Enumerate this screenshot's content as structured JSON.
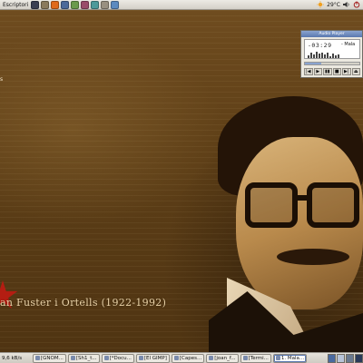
{
  "top_panel": {
    "menu_label": "Escriptori",
    "launchers": [
      {
        "icon": "terminal-icon",
        "color": "#3a3f52"
      },
      {
        "icon": "gimp-icon",
        "color": "#8a7a5c"
      },
      {
        "icon": "firefox-icon",
        "color": "#e06a1b"
      },
      {
        "icon": "app-icon",
        "color": "#4c6a9a"
      },
      {
        "icon": "app-icon",
        "color": "#6a9a4c"
      },
      {
        "icon": "app-icon",
        "color": "#9a4c6a"
      },
      {
        "icon": "app-icon",
        "color": "#4c9a9a"
      },
      {
        "icon": "app-icon",
        "color": "#999080"
      },
      {
        "icon": "app-icon",
        "color": "#5c8ac0"
      }
    ],
    "tray": {
      "weather_icon": "weather-icon",
      "temperature": "29°C",
      "volume_icon": "volume-icon",
      "power_icon": "power-icon"
    }
  },
  "desktop": {
    "icon_label": "s",
    "caption": "an Fuster i Ortells (1922-1992)"
  },
  "audio_player": {
    "title": "Audio Player",
    "time": "-03:29",
    "track": "- Mala",
    "progress": 0.3,
    "bars": [
      0.4,
      0.7,
      0.5,
      0.9,
      0.6,
      0.8,
      0.5,
      0.7,
      0.3,
      0.6,
      0.4,
      0.5
    ],
    "buttons": [
      "|◀",
      "▶",
      "▮▮",
      "■",
      "▶|",
      "⏏"
    ]
  },
  "bottom_panel": {
    "clock": "9,6 kB/s",
    "tasks": [
      {
        "label": "[GNOM...",
        "active": false
      },
      {
        "label": "[Sh1_t...",
        "active": false
      },
      {
        "label": "[*Docu...",
        "active": false
      },
      {
        "label": "[El GIMP]",
        "active": false
      },
      {
        "label": "[Capes...",
        "active": false
      },
      {
        "label": "[joan_f...",
        "active": false
      },
      {
        "label": "[Termi...",
        "active": false
      },
      {
        "label": "1. Mala...",
        "active": true
      }
    ],
    "workspaces": [
      "#4a6aa0",
      "#b8c4d8",
      "#6a7a90",
      "#2a3a5a"
    ]
  }
}
